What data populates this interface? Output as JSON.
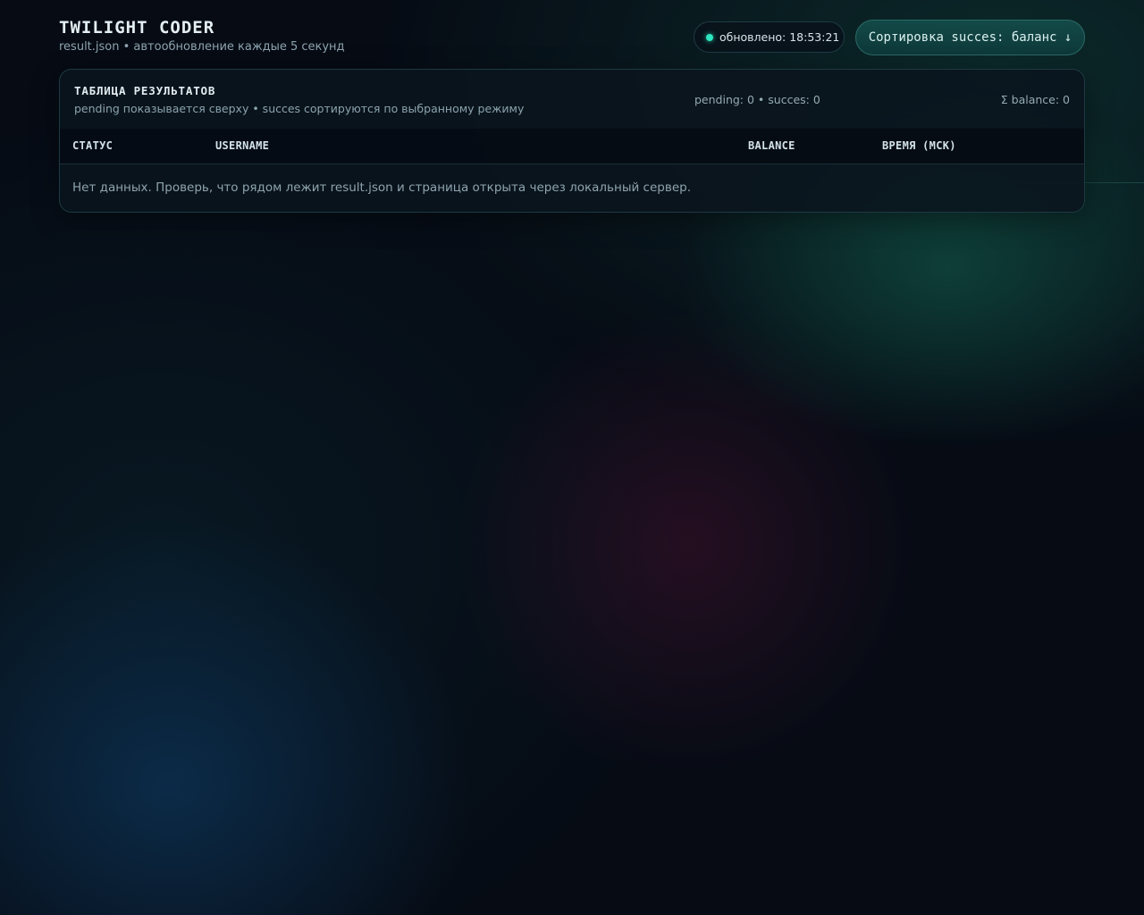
{
  "app": {
    "title": "TWILIGHT CODER",
    "subtitle": "result.json • автообновление каждые 5 секунд"
  },
  "status": {
    "updated_text": "обновлено: 18:53:21",
    "dot_color": "#2ee6c0"
  },
  "sort_button": {
    "label": "Сортировка succes: баланс ↓"
  },
  "panel": {
    "title": "ТАБЛИЦА РЕЗУЛЬТАТОВ",
    "subtitle": "pending показывается сверху • succes сортируются по выбранному режиму",
    "counts": "pending: 0 • succes: 0",
    "balance_total": "Σ balance: 0"
  },
  "table": {
    "columns": [
      "СТАТУС",
      "USERNAME",
      "BALANCE",
      "ВРЕМЯ (МСК)"
    ],
    "rows": [],
    "empty_message": "Нет данных. Проверь, что рядом лежит result.json и страница открыта через локальный сервер."
  },
  "colors": {
    "accent": "#2ee6c0",
    "background": "#060b14",
    "panel_border": "#1d3a42"
  }
}
